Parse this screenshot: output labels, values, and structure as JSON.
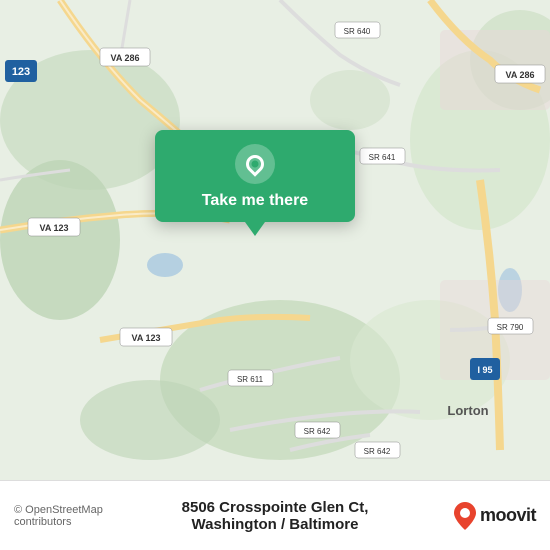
{
  "map": {
    "attribution": "© OpenStreetMap contributors",
    "background_color": "#e8f0e4"
  },
  "popup": {
    "button_label": "Take me there",
    "pin_icon": "location-pin"
  },
  "bottom_bar": {
    "address": "8506 Crosspointe Glen Ct, Washington / Baltimore",
    "copyright": "© OpenStreetMap contributors",
    "logo_text": "moovit"
  },
  "road_labels": [
    "VA 286",
    "VA 286",
    "VA 123",
    "VA 123",
    "SR 640",
    "SR 641",
    "SR 611",
    "SR 642",
    "SR 642",
    "SR 790",
    "I 95",
    "123",
    "Lorton"
  ]
}
